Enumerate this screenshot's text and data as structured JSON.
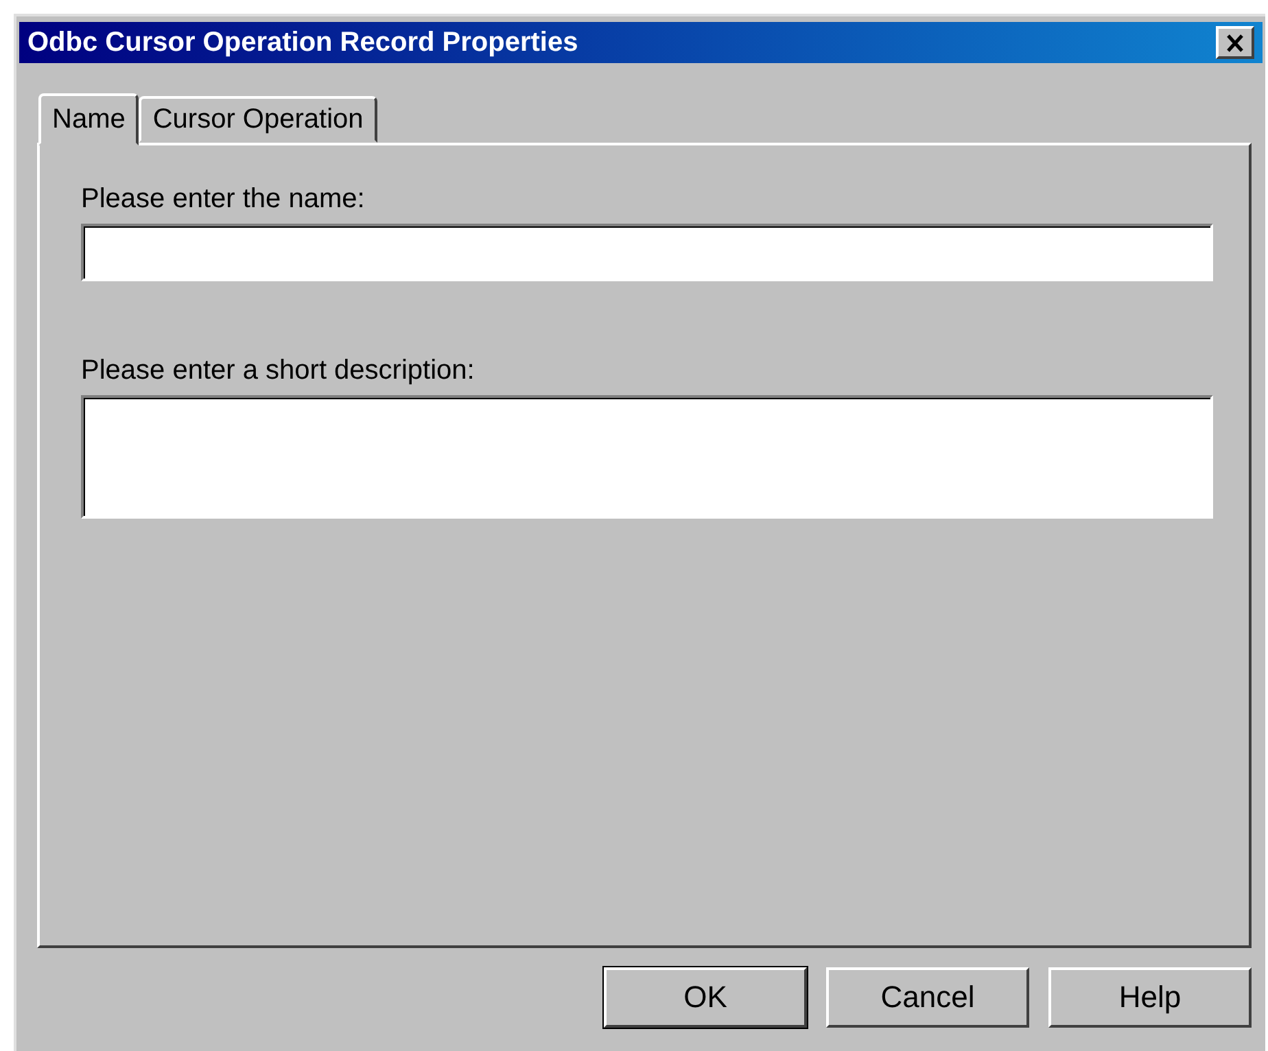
{
  "window": {
    "title": "Odbc Cursor Operation Record Properties"
  },
  "tabs": [
    {
      "label": "Name",
      "selected": true
    },
    {
      "label": "Cursor Operation",
      "selected": false
    }
  ],
  "fields": [
    {
      "label": "Please enter the name:",
      "kind": "single"
    },
    {
      "label": "Please enter a short description:",
      "kind": "multi"
    }
  ],
  "buttons": [
    "OK",
    "Cancel",
    "Help"
  ]
}
